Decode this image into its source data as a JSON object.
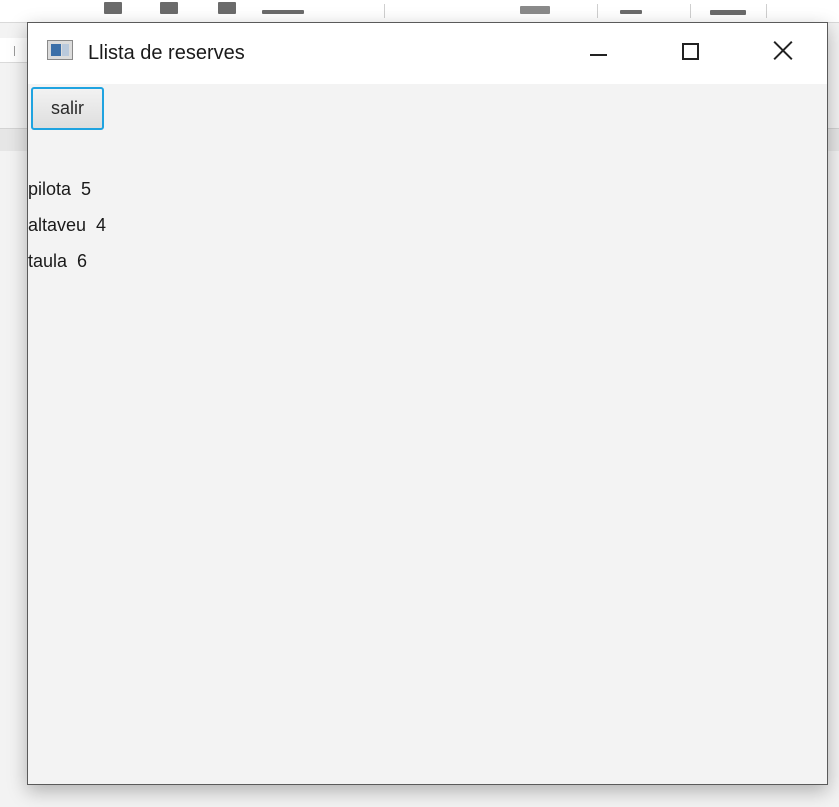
{
  "window": {
    "title": "Llista de reserves",
    "icon": "java-app-window-icon",
    "controls": {
      "minimize_icon": "minimize-icon",
      "maximize_icon": "maximize-icon",
      "close_icon": "close-icon"
    }
  },
  "toolbar": {
    "salir_label": "salir"
  },
  "reservations": [
    {
      "text": "pilota  5"
    },
    {
      "text": "altaveu  4"
    },
    {
      "text": "taula  6"
    }
  ],
  "colors": {
    "button_focus_border": "#1fa3e0",
    "client_background": "#f3f3f3",
    "titlebar_background": "#ffffff"
  }
}
